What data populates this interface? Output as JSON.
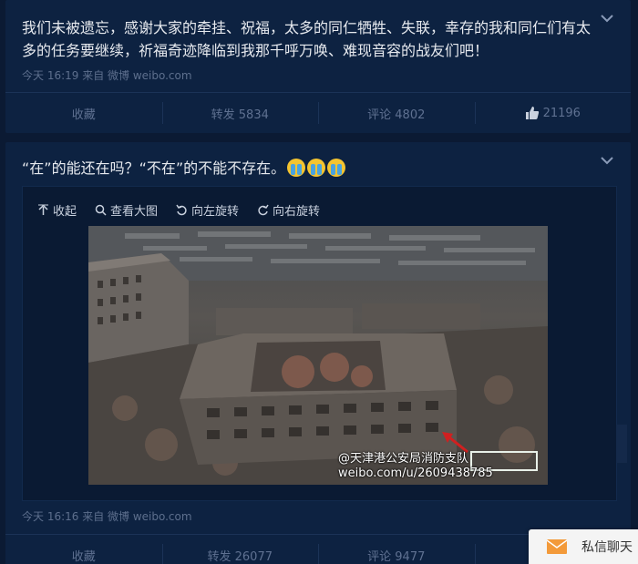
{
  "posts": [
    {
      "text": "我们未被遗忘，感谢大家的牵挂、祝福，太多的同仁牺牲、失联，幸存的我和同仁们有太多的任务要继续，祈福奇迹降临到我那千呼万唤、难现音容的战友们吧！",
      "meta": "今天 16:19 来自 微博 weibo.com",
      "actions": {
        "favorite": "收藏",
        "repost": "转发 5834",
        "comment": "评论 4802",
        "like": "21196"
      }
    },
    {
      "text": "“在”的能还在吗？“不在”的不能不存在。",
      "emoji": [
        "crying-emoji",
        "crying-emoji",
        "crying-emoji"
      ],
      "media": {
        "toolbar": {
          "collapse": "收起",
          "view_large": "查看大图",
          "rotate_left": "向左旋转",
          "rotate_right": "向右旋转"
        },
        "watermark_line1": "@天津港公安局消防支队",
        "watermark_line2": "weibo.com/u/2609438785"
      },
      "meta": "今天 16:16 来自 微博 weibo.com",
      "actions": {
        "favorite": "收藏",
        "repost": "转发 26077",
        "comment": "评论 9477"
      }
    }
  ],
  "chat_popup": {
    "label": "私信聊天"
  },
  "colors": {
    "background": "#0b1a33",
    "card": "#0d2241",
    "muted_text": "#5f7191",
    "body_text": "#e6e9ee"
  }
}
